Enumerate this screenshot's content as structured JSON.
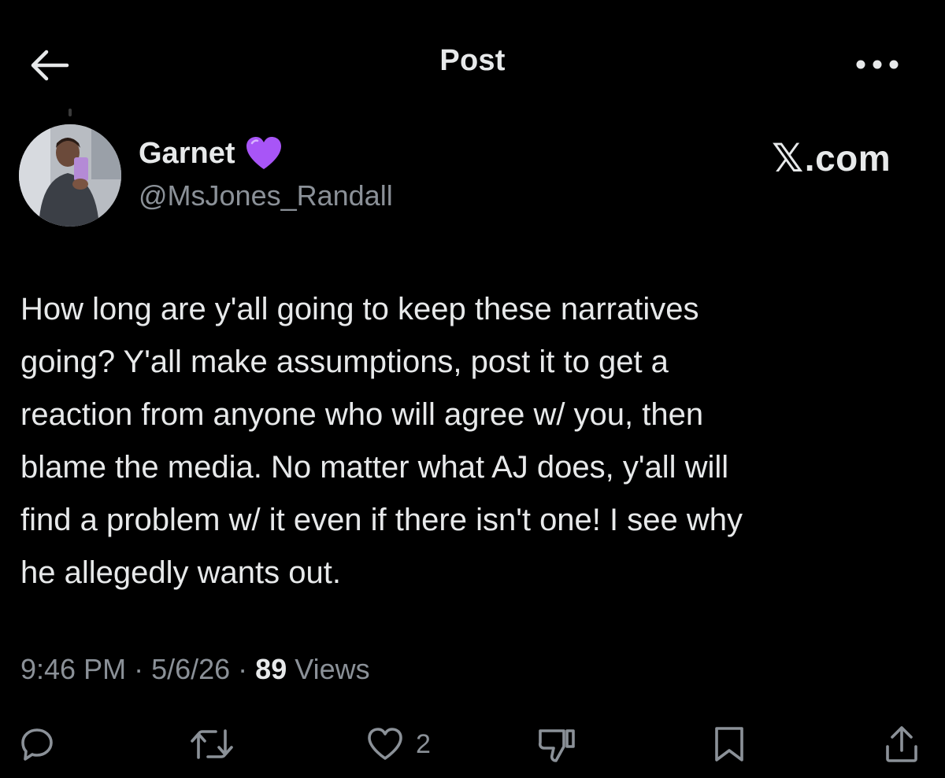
{
  "header": {
    "title": "Post",
    "back_icon": "arrow-left-icon",
    "more_icon": "more-horizontal-icon"
  },
  "author": {
    "display_name": "Garnet",
    "badge_icon": "purple-heart-icon",
    "badge_color": "#a855f7",
    "handle": "@MsJones_Randall"
  },
  "watermark": {
    "mark": "𝕏",
    "text": ".com"
  },
  "post": {
    "text": "How long are y'all going to keep these narratives\ngoing? Y'all make assumptions,  post it to get a\nreaction from anyone who will agree w/ you, then\nblame the media. No matter what AJ does, y'all will\nfind a problem w/ it even if there isn't one! I see why\nhe allegedly wants out."
  },
  "meta": {
    "time": "9:46 PM",
    "separator": "·",
    "date": "5/6/26",
    "views_count": "89",
    "views_label": "Views"
  },
  "actions": {
    "reply_icon": "reply-icon",
    "repost_icon": "repost-icon",
    "like_icon": "heart-outline-icon",
    "like_count": "2",
    "dislike_icon": "thumbs-down-icon",
    "bookmark_icon": "bookmark-icon",
    "share_icon": "share-icon"
  },
  "colors": {
    "background": "#000000",
    "text_primary": "#e7e9ea",
    "text_secondary": "#8b9198",
    "icon_gray": "#8b9198"
  }
}
